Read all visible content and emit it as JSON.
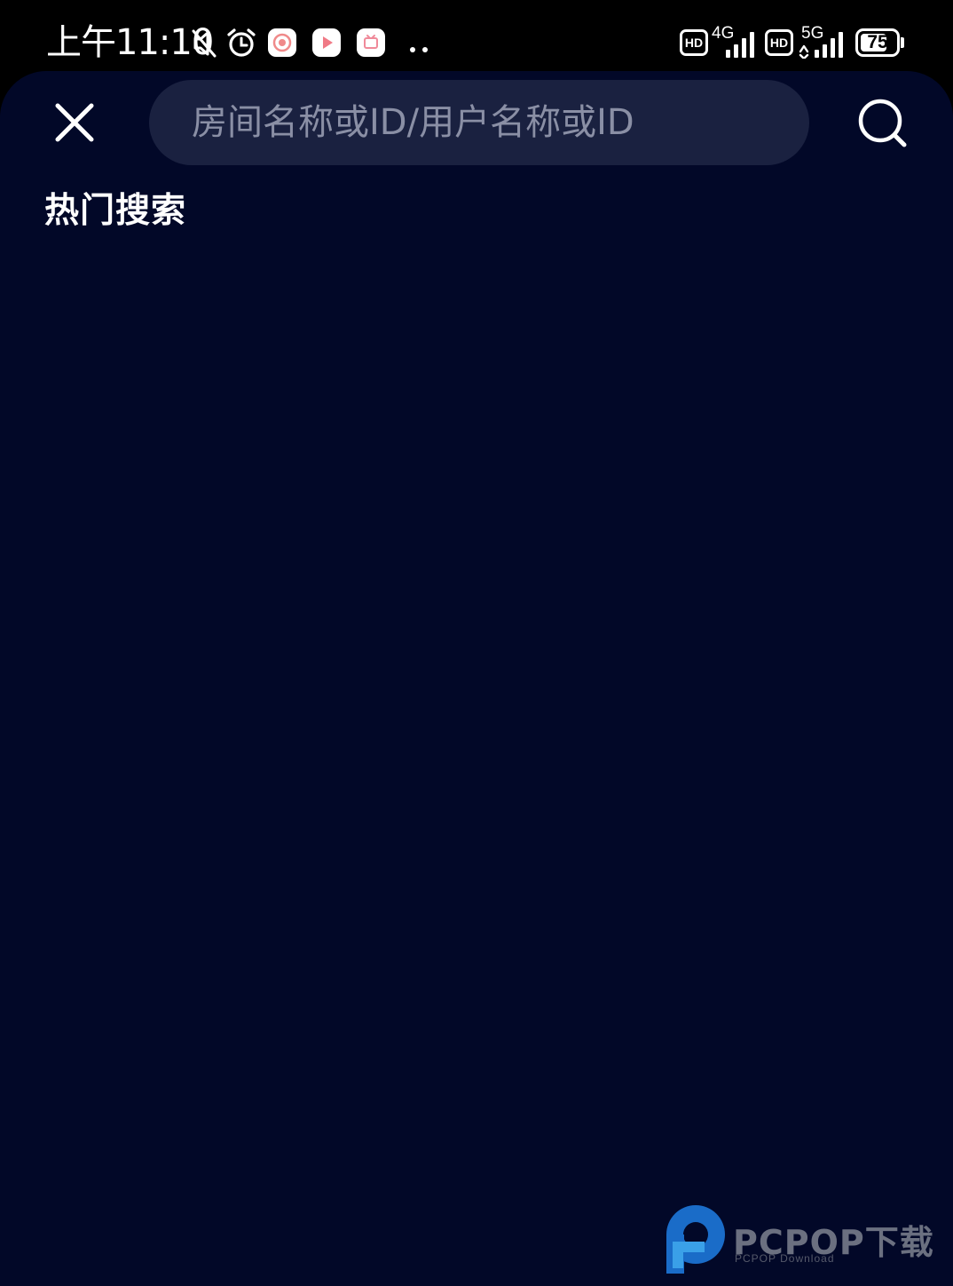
{
  "status_bar": {
    "time": "上午11:10",
    "net1_label": "4G",
    "net2_label": "5G",
    "hd_label": "HD",
    "battery_percent": 75,
    "battery_label": "75",
    "icons": [
      "mute-icon",
      "alarm-icon",
      "app-notification-icon",
      "video-notification-icon",
      "tv-notification-icon",
      "more-notifications-icon",
      "hd-voice-icon",
      "signal-icon",
      "battery-icon"
    ]
  },
  "search": {
    "placeholder": "房间名称或ID/用户名称或ID",
    "value": ""
  },
  "hot_search": {
    "title": "热门搜索",
    "items": []
  },
  "watermark": {
    "main": "PCPOP下载",
    "sub": "PCPOP Download"
  },
  "colors": {
    "background": "#020828",
    "search_field": "#1a2140",
    "placeholder": "#8a8fa5",
    "text": "#ffffff",
    "watermark_blue": "#1a6cc8"
  }
}
